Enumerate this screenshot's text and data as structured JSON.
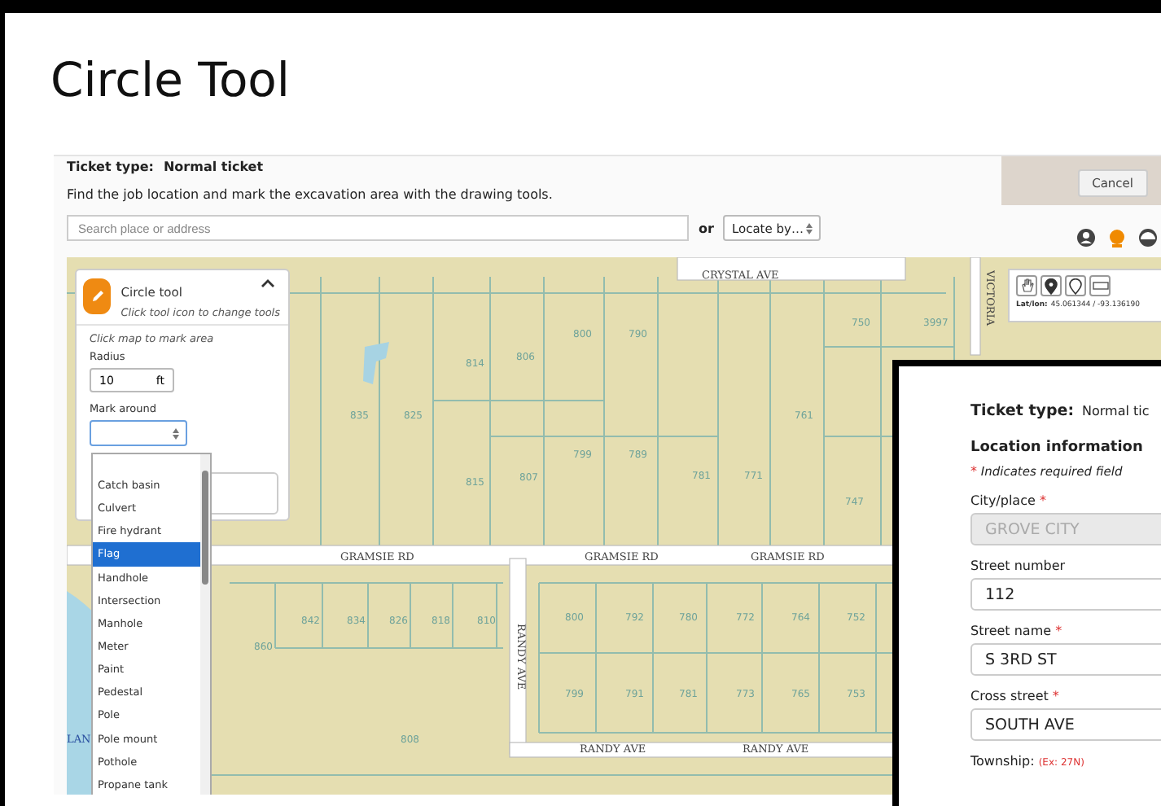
{
  "slide_title": "Circle Tool",
  "header": {
    "ticket_label": "Ticket type:",
    "ticket_value": "Normal ticket",
    "instructions": "Find the job location and mark the excavation area with the drawing tools.",
    "cancel_button": "Cancel",
    "search": {
      "placeholder": "Search place or address"
    },
    "or_label": "or",
    "locate_select": "Locate by…"
  },
  "tool_panel": {
    "title": "Circle tool",
    "hint": "Click tool icon to change tools",
    "instruction": "Click map to mark area",
    "radius_label": "Radius",
    "radius_value": "10",
    "radius_unit": "ft",
    "mark_around_label": "Mark around",
    "options": [
      {
        "label": "Catch basin",
        "selected": false
      },
      {
        "label": "Culvert",
        "selected": false
      },
      {
        "label": "Fire hydrant",
        "selected": false
      },
      {
        "label": "Flag",
        "selected": true
      },
      {
        "label": "Handhole",
        "selected": false
      },
      {
        "label": "Intersection",
        "selected": false
      },
      {
        "label": "Manhole",
        "selected": false
      },
      {
        "label": "Meter",
        "selected": false
      },
      {
        "label": "Paint",
        "selected": false
      },
      {
        "label": "Pedestal",
        "selected": false
      },
      {
        "label": "Pole",
        "selected": false
      },
      {
        "label": "Pole mount",
        "selected": false
      },
      {
        "label": "Pothole",
        "selected": false
      },
      {
        "label": "Propane tank",
        "selected": false
      }
    ]
  },
  "map": {
    "roads": [
      {
        "name": "CRYSTAL AVE",
        "kind": "horizontal"
      },
      {
        "name": "GRAMSIE RD",
        "kind": "horizontal"
      },
      {
        "name": "GRAMSIE RD",
        "kind": "horizontal"
      },
      {
        "name": "GRAMSIE RD",
        "kind": "horizontal"
      },
      {
        "name": "RANDY AVE",
        "kind": "vertical"
      },
      {
        "name": "RANDY AVE",
        "kind": "horizontal"
      },
      {
        "name": "RANDY AVE",
        "kind": "horizontal"
      },
      {
        "name": "VICTORIA",
        "kind": "vertical"
      }
    ],
    "water_label": "LAN",
    "parcels": [
      "814",
      "806",
      "800",
      "790",
      "750",
      "3997",
      "835",
      "825",
      "815",
      "807",
      "799",
      "789",
      "781",
      "771",
      "761",
      "747",
      "842",
      "834",
      "826",
      "818",
      "810",
      "860",
      "800",
      "792",
      "780",
      "772",
      "764",
      "752",
      "799",
      "791",
      "781",
      "773",
      "765",
      "753",
      "808"
    ],
    "latlon_label": "Lat/lon:",
    "latlon_value": "45.061344 / -93.136190"
  },
  "location_form": {
    "ticket_label": "Ticket type:",
    "ticket_value": "Normal tic",
    "heading": "Location information",
    "required_mark": "*",
    "required_note": "Indicates required field",
    "fields": [
      {
        "label": "City/place",
        "required": true,
        "value": "GROVE CITY",
        "disabled": true
      },
      {
        "label": "Street number",
        "required": false,
        "value": "112",
        "disabled": false
      },
      {
        "label": "Street name",
        "required": true,
        "value": "S 3RD ST",
        "disabled": false
      },
      {
        "label": "Cross street",
        "required": true,
        "value": "SOUTH AVE",
        "disabled": false
      }
    ],
    "township_label": "Township:",
    "township_example": "(Ex: 27N)"
  }
}
